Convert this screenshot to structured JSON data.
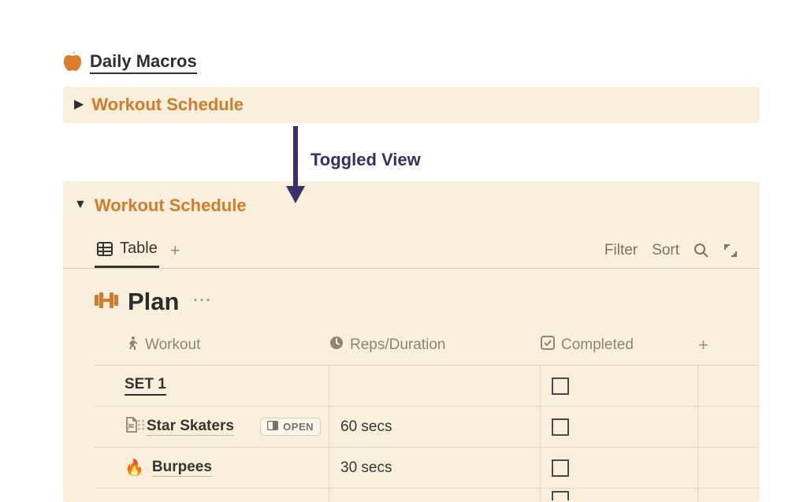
{
  "daily_macros_title": "Daily Macros",
  "toggle_collapsed_title": "Workout Schedule",
  "annotation_label": "Toggled View",
  "toggle_expanded_title": "Workout Schedule",
  "tabs": {
    "table_label": "Table"
  },
  "filters": {
    "filter_label": "Filter",
    "sort_label": "Sort"
  },
  "db": {
    "title": "Plan"
  },
  "columns": {
    "workout": "Workout",
    "reps": "Reps/Duration",
    "completed": "Completed"
  },
  "rows": [
    {
      "title": "SET 1",
      "reps": "",
      "completed": false
    },
    {
      "title": "Star Skaters",
      "reps": "60 secs",
      "completed": false
    },
    {
      "title": "Burpees",
      "reps": "30 secs",
      "completed": false
    }
  ],
  "open_btn_label": "OPEN"
}
